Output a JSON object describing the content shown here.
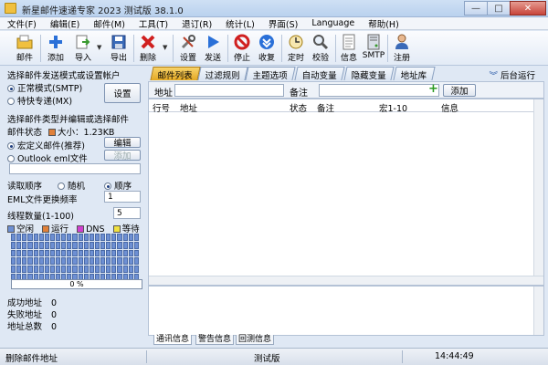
{
  "window": {
    "title": "新星邮件速递专家 2023 测试版 38.1.0",
    "minimize": "—",
    "maximize": "□",
    "close": "✕"
  },
  "menu": [
    "文件(F)",
    "编辑(E)",
    "邮件(M)",
    "工具(T)",
    "退订(R)",
    "统计(L)",
    "界面(S)",
    "Language",
    "帮助(H)"
  ],
  "toolbar": {
    "mail": "邮件",
    "add": "添加",
    "import": "导入",
    "export": "导出",
    "delete": "删除",
    "settings": "设置",
    "send": "发送",
    "stop": "停止",
    "receive": "收复",
    "schedule": "定时",
    "verify": "校验",
    "info": "信息",
    "smtp": "SMTP",
    "register": "注册",
    "dropdown_arrow": "▼"
  },
  "left": {
    "send_mode_title": "选择邮件发送模式或设置帐户",
    "normal_mode": "正常模式(SMTP)",
    "special_mode": "特快专递(MX)",
    "settings_button": "设置",
    "type_title": "选择邮件类型并编辑或选择邮件",
    "mail_status_label": "邮件状态",
    "size_label": "大小：1.23KB",
    "macro_mail": "宏定义邮件(推荐)",
    "edit_button": "编辑",
    "outlook_eml": "Outlook eml文件",
    "add_button": "添加",
    "read_order_label": "读取顺序",
    "random": "随机",
    "sequential": "顺序",
    "eml_freq_label": "EML文件更换频率",
    "eml_freq_value": "1",
    "thread_label": "线程数量(1-100)",
    "thread_value": "5",
    "legend": [
      {
        "label": "空闲",
        "color": "#6d8fd3"
      },
      {
        "label": "运行",
        "color": "#e0803a"
      },
      {
        "label": "DNS",
        "color": "#d040d0"
      },
      {
        "label": "等待",
        "color": "#f0e040"
      }
    ],
    "progress_text": "0 %",
    "success_label": "成功地址",
    "success_value": "0",
    "fail_label": "失败地址",
    "fail_value": "0",
    "total_label": "地址总数",
    "total_value": "0"
  },
  "tabs": [
    "邮件列表",
    "过滤规则",
    "主题选项",
    "自动变量",
    "隐藏变量",
    "地址库"
  ],
  "background_run": "后台运行",
  "filter": {
    "address_label": "地址",
    "note_label": "备注",
    "add_button": "添加",
    "plus": "+"
  },
  "table": {
    "columns": [
      "行号",
      "地址",
      "状态",
      "备注",
      "宏1-10",
      "信息"
    ]
  },
  "log_tabs": [
    "通讯信息",
    "警告信息",
    "回测信息"
  ],
  "status": {
    "left": "删除邮件地址",
    "mode": "测试版",
    "time": "14:44:49"
  },
  "colors": {
    "accent": "#e4a824",
    "status_orange": "#e0803a"
  }
}
